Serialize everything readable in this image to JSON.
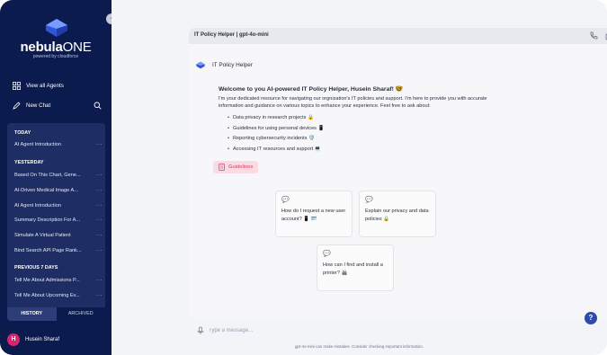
{
  "app": {
    "brand_bold": "nebula",
    "brand_light": "ONE",
    "tagline": "powered by cloudforce",
    "accent": "#0c1b4d"
  },
  "sidebar": {
    "nav": [
      {
        "label": "View all Agents",
        "icon": "grid-icon"
      },
      {
        "label": "New Chat",
        "icon": "new-chat-icon"
      }
    ],
    "sections": [
      {
        "heading": "TODAY",
        "items": [
          "AI Agent Introduction"
        ]
      },
      {
        "heading": "YESTERDAY",
        "items": [
          "Based On This Chart, Gene...",
          "AI-Driven Medical Image A...",
          "AI Agent Introduction",
          "Summary Description For A...",
          "Simulate A Virtual Patient",
          "Bind Search API Page Rank..."
        ]
      },
      {
        "heading": "PREVIOUS 7 DAYS",
        "items": [
          "Tell Me About Admissions P...",
          "Tell Me About Upcoming Ev..."
        ]
      }
    ],
    "item_menu": "···",
    "tabs": {
      "history": "HISTORY",
      "archived": "ARCHIVED"
    },
    "user": {
      "initial": "H",
      "name": "Husein Sharaf"
    }
  },
  "chat": {
    "title": "IT Policy Helper | gpt-4o-mini",
    "assistant_name": "IT Policy Helper",
    "welcome_title": "Welcome to you AI-powered IT Policy Helper, Husein Sharaf! 🤓",
    "welcome_body": "I'm your dedicated resource for navigating our orgnization's IT policies and support. I'm here to provide you with accurate information and guidance on various topics to enhance your experience. Feel free to ask about:",
    "topics": [
      "Data privacy in research projects 🔒",
      "Guidelines for using personal devices 📱",
      "Reporting cybersecurity incidents 🛡️",
      "Accessing IT resources and support 💻"
    ],
    "guidelines_label": "Guidelines",
    "suggestions": [
      "How do I request a new user account? 📱 🪪",
      "Explain our privacy and data policies 🔒",
      "How can I find and install a printer? 🖨️"
    ],
    "composer_placeholder": "Type a message...",
    "disclaimer": "gpt-4o-mini can make mistakes. Consider checking important information."
  }
}
